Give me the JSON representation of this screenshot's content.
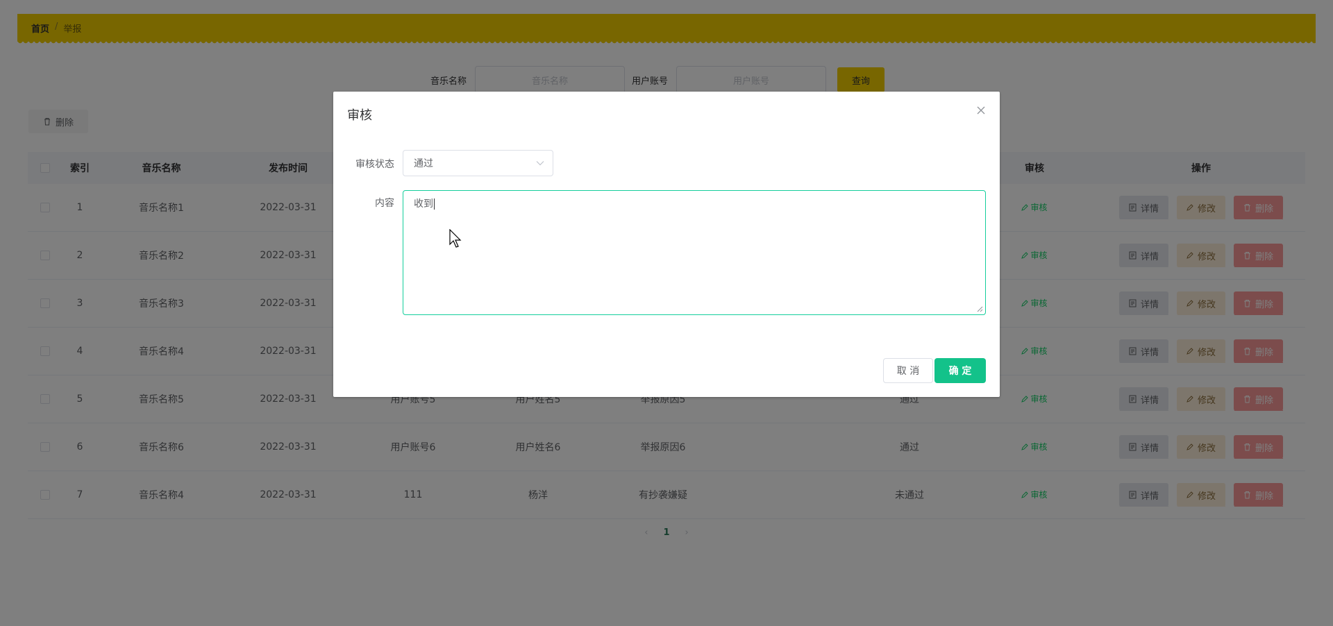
{
  "breadcrumb": {
    "home": "首页",
    "separator": "/",
    "current": "举报"
  },
  "search": {
    "music_name_label": "音乐名称",
    "music_name_placeholder": "音乐名称",
    "user_account_label": "用户账号",
    "user_account_placeholder": "用户账号",
    "query_button": "查询"
  },
  "toolbar": {
    "delete_label": "删除"
  },
  "table": {
    "headers": [
      "索引",
      "音乐名称",
      "发布时间",
      "",
      "",
      "",
      "",
      "",
      "审核",
      "操作"
    ],
    "rows": [
      {
        "index": "1",
        "name": "音乐名称1",
        "date": "2022-03-31",
        "account": "",
        "user_name": "",
        "reason": "",
        "status": "",
        "audit": "审核"
      },
      {
        "index": "2",
        "name": "音乐名称2",
        "date": "2022-03-31",
        "account": "",
        "user_name": "",
        "reason": "",
        "status": "",
        "audit": "审核"
      },
      {
        "index": "3",
        "name": "音乐名称3",
        "date": "2022-03-31",
        "account": "",
        "user_name": "",
        "reason": "",
        "status": "",
        "audit": "审核"
      },
      {
        "index": "4",
        "name": "音乐名称4",
        "date": "2022-03-31",
        "account": "",
        "user_name": "",
        "reason": "",
        "status": "",
        "audit": "审核"
      },
      {
        "index": "5",
        "name": "音乐名称5",
        "date": "2022-03-31",
        "account": "用户账号5",
        "user_name": "用户姓名5",
        "reason": "举报原因5",
        "status": "通过",
        "audit": "审核"
      },
      {
        "index": "6",
        "name": "音乐名称6",
        "date": "2022-03-31",
        "account": "用户账号6",
        "user_name": "用户姓名6",
        "reason": "举报原因6",
        "status": "通过",
        "audit": "审核"
      },
      {
        "index": "7",
        "name": "音乐名称4",
        "date": "2022-03-31",
        "account": "111",
        "user_name": "杨洋",
        "reason": "有抄袭嫌疑",
        "status": "未通过",
        "audit": "审核"
      }
    ],
    "ops": {
      "detail": "详情",
      "edit": "修改",
      "delete": "删除"
    }
  },
  "pager": {
    "prev": "‹",
    "current": "1",
    "next": "›"
  },
  "modal": {
    "title": "审核",
    "status_label": "审核状态",
    "status_value": "通过",
    "content_label": "内容",
    "content_value": "收到",
    "cancel": "取 消",
    "confirm": "确 定"
  },
  "colors": {
    "accent_yellow": "#f0cc00",
    "primary_green": "#13c28a",
    "danger": "#f89898"
  }
}
